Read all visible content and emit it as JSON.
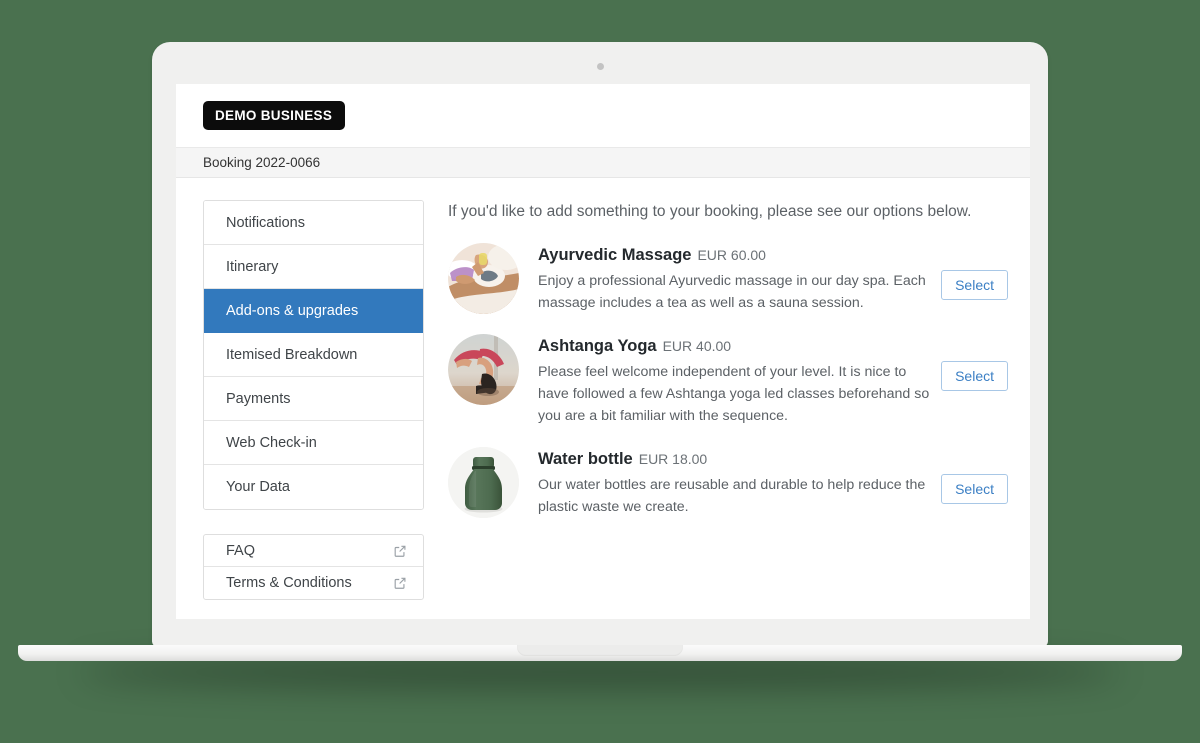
{
  "brand": {
    "logo_text": "DEMO BUSINESS"
  },
  "booking_bar": {
    "label": "Booking 2022-0066"
  },
  "sidebar": {
    "nav_items": [
      {
        "label": "Notifications",
        "active": false
      },
      {
        "label": "Itinerary",
        "active": false
      },
      {
        "label": "Add-ons & upgrades",
        "active": true
      },
      {
        "label": "Itemised Breakdown",
        "active": false
      },
      {
        "label": "Payments",
        "active": false
      },
      {
        "label": "Web Check-in",
        "active": false
      },
      {
        "label": "Your Data",
        "active": false
      }
    ],
    "external_links": [
      {
        "label": "FAQ",
        "icon": "external-link-icon"
      },
      {
        "label": "Terms & Conditions",
        "icon": "external-link-icon"
      }
    ]
  },
  "main": {
    "intro": "If you'd like to add something to your booking, please see our options below.",
    "addons": [
      {
        "name": "Ayurvedic Massage",
        "price": "EUR 60.00",
        "description": "Enjoy a professional Ayurvedic massage in our day spa. Each massage includes a tea as well as a sauna session.",
        "button_label": "Select",
        "thumbnail": "massage-photo"
      },
      {
        "name": "Ashtanga Yoga",
        "price": "EUR 40.00",
        "description": "Please feel welcome independent of your level. It is nice to have followed a few Ashtanga yoga led classes beforehand so you are a bit familiar with the sequence.",
        "button_label": "Select",
        "thumbnail": "yoga-photo"
      },
      {
        "name": "Water bottle",
        "price": "EUR 18.00",
        "description": "Our water bottles are reusable and durable to help reduce the plastic waste we create.",
        "button_label": "Select",
        "thumbnail": "water-bottle-photo"
      }
    ]
  },
  "colors": {
    "page_background": "#4a714f",
    "accent_blue": "#3279bd",
    "button_blue": "#3b7fc4",
    "logo_background": "#0c0c0c",
    "booking_bar_background": "#f5f5f5"
  }
}
